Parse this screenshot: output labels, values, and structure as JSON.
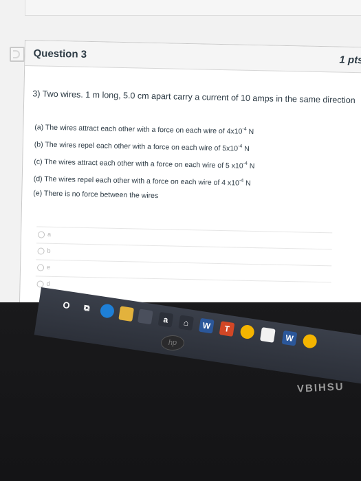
{
  "question": {
    "title": "Question 3",
    "points": "1 pts",
    "text": "3) Two wires. 1 m long, 5.0 cm apart carry a current of 10 amps in the same direction",
    "options": [
      {
        "pre": "(a) The wires attract each other with a force on each wire of 4x10",
        "exp": "-4",
        "post": " N"
      },
      {
        "pre": "(b) The wires repel each other with a force on each wire of 5x10",
        "exp": "-4",
        "post": " N"
      },
      {
        "pre": "(c) The wires attract each other with a force on each wire of 5 x10",
        "exp": "-4",
        "post": " N"
      },
      {
        "pre": "(d) The wires repel each other with a force on each wire of 4 x10",
        "exp": "-4",
        "post": " N"
      },
      {
        "pre": "(e) There is no force between the wires",
        "exp": "",
        "post": ""
      }
    ],
    "choices": [
      "a",
      "b",
      "e",
      "d"
    ]
  },
  "taskbar": {
    "start_glyph": "O",
    "task_view_glyph": "⧉",
    "amazon_glyph": "a",
    "word_glyph": "W",
    "ppt_glyph": "T",
    "word2_glyph": "W"
  },
  "device": {
    "hp_label": "hp",
    "brand_text": "VBIHSU"
  },
  "colors": {
    "text": "#2d3b45",
    "taskbar": "#2c3039"
  }
}
